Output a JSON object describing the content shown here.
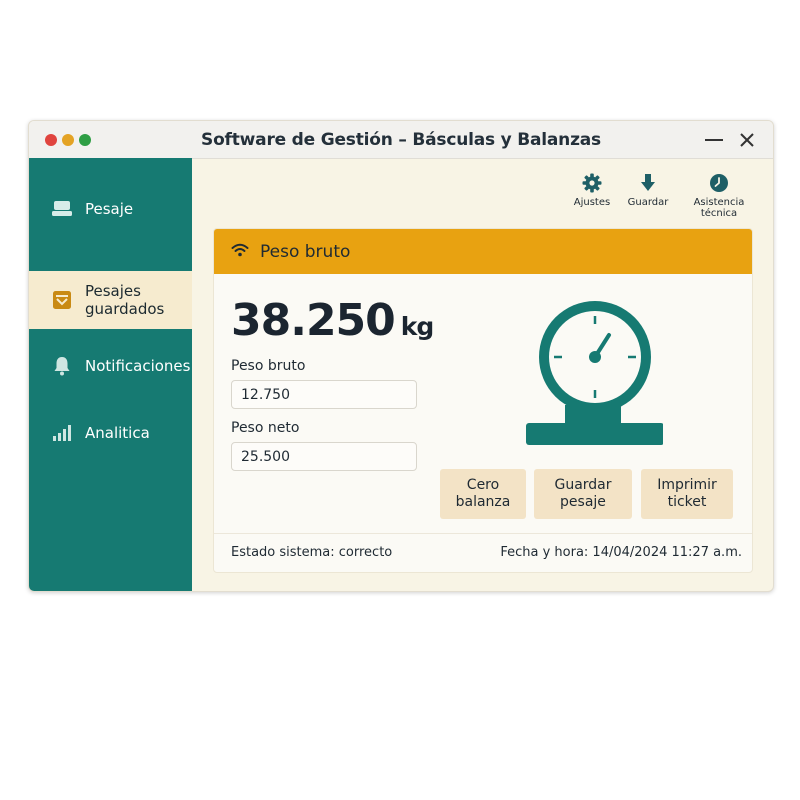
{
  "window": {
    "title": "Software de Gestión – Básculas y Balanzas"
  },
  "sidebar": {
    "items": [
      {
        "label": "Pesaje",
        "icon": "scale-icon",
        "active": false
      },
      {
        "label": "Pesajes guardados",
        "icon": "saved-box-icon",
        "active": true
      },
      {
        "label": "Notificaciones",
        "icon": "bell-icon",
        "active": false
      },
      {
        "label": "Analitica",
        "icon": "bar-chart-icon",
        "active": false
      }
    ]
  },
  "toolbar": {
    "settings_label": "Ajustes",
    "save_label": "Guardar",
    "support_label": "Asistencia técnica"
  },
  "panel": {
    "title": "Peso bruto",
    "weight_value": "38.250",
    "weight_unit": "kg",
    "gross_label": "Peso bruto",
    "gross_value": "12.750",
    "net_label": "Peso neto",
    "net_value": "25.500"
  },
  "actions": {
    "zero_line1": "Cero",
    "zero_line2": "balanza",
    "save_line1": "Guardar",
    "save_line2": "pesaje",
    "print_line1": "Imprimir",
    "print_line2": "ticket"
  },
  "footer": {
    "status": "Estado sistema: correcto",
    "datetime": "Fecha y hora: 14/04/2024 11:27 a.m."
  },
  "colors": {
    "sidebar": "#167a72",
    "accent": "#e8a211",
    "active_item": "#f6ebcf",
    "button": "#f3e3c6"
  }
}
